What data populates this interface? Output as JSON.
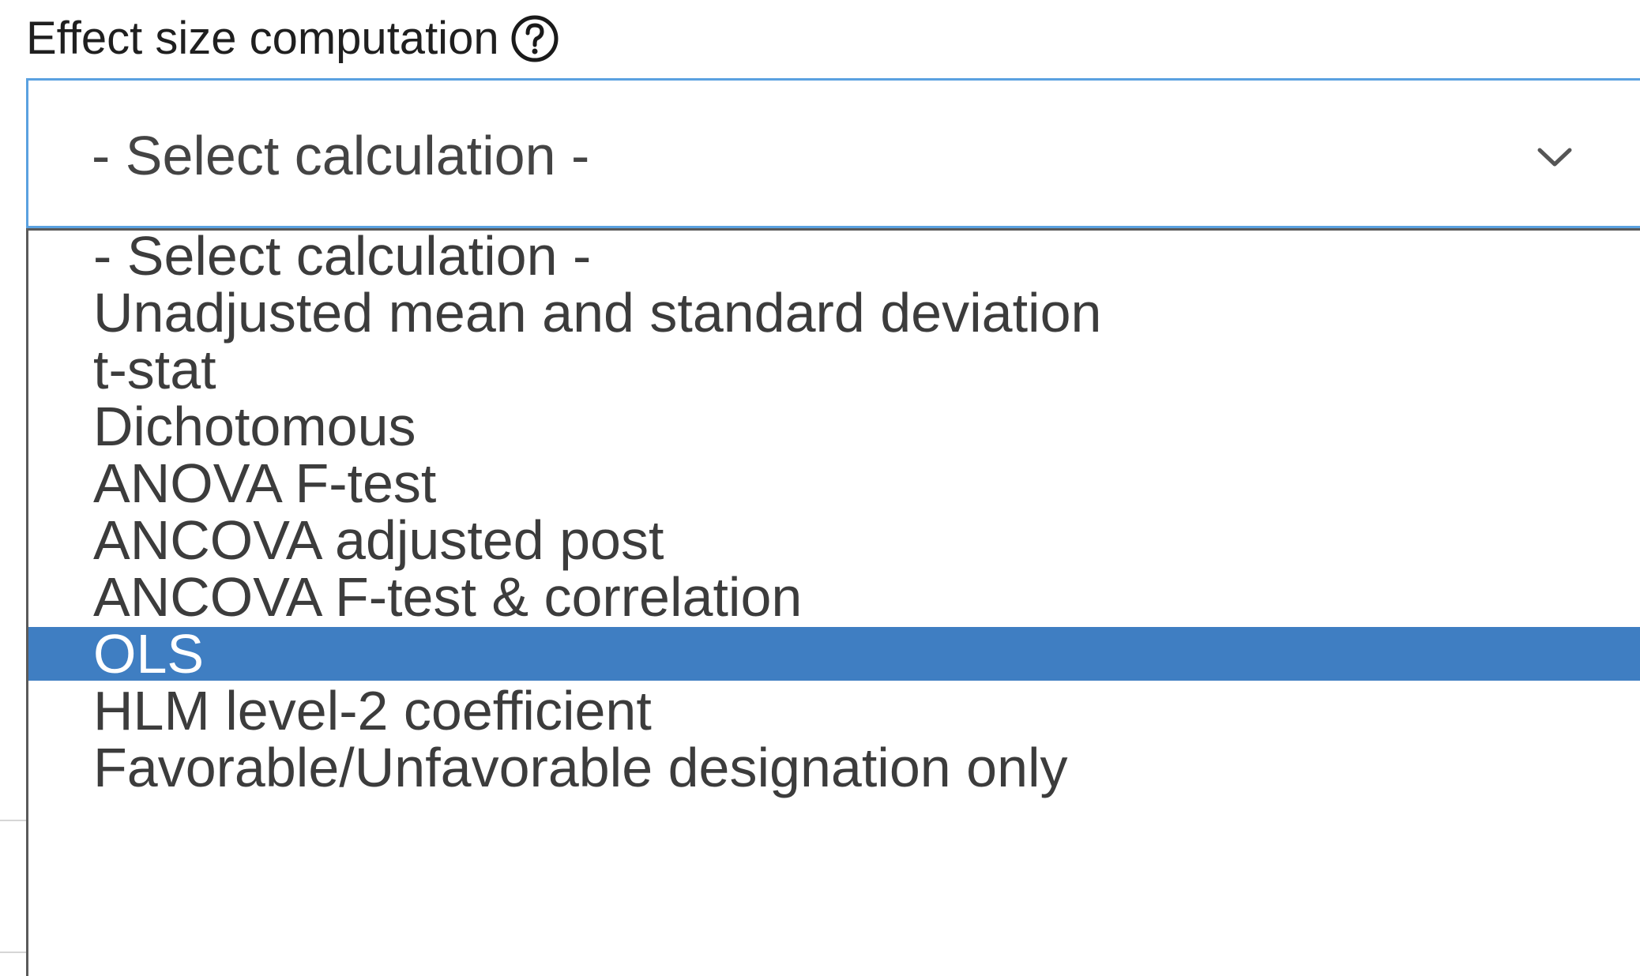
{
  "field": {
    "label": "Effect size computation",
    "help_icon": "question-circle-icon"
  },
  "select": {
    "value": "- Select calculation -",
    "chevron_icon": "chevron-down-icon",
    "focus_color": "#5aa1e0"
  },
  "dropdown": {
    "highlight_color": "#3f7ec2",
    "selected_index": 7,
    "options": [
      {
        "label": "- Select calculation -"
      },
      {
        "label": "Unadjusted mean and standard deviation"
      },
      {
        "label": "t-stat"
      },
      {
        "label": "Dichotomous"
      },
      {
        "label": "ANOVA F-test"
      },
      {
        "label": "ANCOVA adjusted post"
      },
      {
        "label": "ANCOVA F-test & correlation"
      },
      {
        "label": "OLS"
      },
      {
        "label": "HLM level-2 coefficient"
      },
      {
        "label": "Favorable/Unfavorable designation only"
      }
    ]
  }
}
